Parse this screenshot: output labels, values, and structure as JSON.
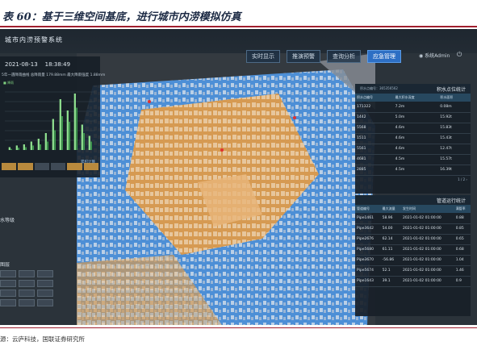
{
  "doc": {
    "title": "表 60：基于三维空间基底，进行城市内涝模拟仿真",
    "source": "源：云庐科技，国联证券研究所"
  },
  "app": {
    "system_title": "城市内涝预警系统",
    "nav_tabs": [
      "实时显示",
      "推演预警",
      "查询分析",
      "应急管理"
    ],
    "active_tab": 3,
    "user_label": "系统Admin"
  },
  "left_panel": {
    "date": "2021-08-13",
    "time": "18:38:49",
    "rain_caption": "5年一遇降雨曲线 总降雨量 179.88mm 最大降雨强度 1.88mm",
    "legend_label": "降雨",
    "buttons": [
      "",
      "",
      "",
      "",
      "",
      ""
    ],
    "data_link": "累积计算",
    "mid_label": "水等级",
    "tools_title": "图层"
  },
  "right_panel_1": {
    "title": "积水点位统计",
    "subtitle": "积水点编号：365356562",
    "columns": [
      "积水点编号",
      "最大积水深度",
      "积水面积"
    ],
    "rows": [
      [
        "171322",
        "7.2m",
        "0.08m"
      ],
      [
        "1442",
        "5.0m",
        "15.92t"
      ],
      [
        "5568",
        "4.6m",
        "15.83t"
      ],
      [
        "1511",
        "4.6m",
        "15.43t"
      ],
      [
        "5561",
        "4.6m",
        "12.47t"
      ],
      [
        "4681",
        "4.5m",
        "15.57t"
      ],
      [
        "2885",
        "4.5m",
        "16.39t"
      ]
    ],
    "pager": "1 / 2  ›"
  },
  "right_panel_2": {
    "title": "管道运行统计",
    "columns": [
      "管道编号",
      "最大流量",
      "发生时间",
      "满管率"
    ],
    "rows": [
      [
        "Pipe1461",
        "58.96",
        "2021-01-02 01:00:00",
        "0.88"
      ],
      [
        "Pipe3642",
        "54.00",
        "2021-01-02 01:00:00",
        "0.85"
      ],
      [
        "Pipe2676",
        "62.14",
        "2021-01-02 01:00:00",
        "0.65"
      ],
      [
        "Pipe5680",
        "61.11",
        "2021-01-02 01:00:00",
        "0.68"
      ],
      [
        "Pipe3670",
        "-56.86",
        "2021-01-02 01:00:00",
        "1.04"
      ],
      [
        "Pipe5674",
        "52.1",
        "2021-01-02 01:00:00",
        "1.46"
      ],
      [
        "Pipe1643",
        "39.1",
        "2021-01-02 01:00:00",
        "0.9"
      ]
    ]
  },
  "rain_bars": {
    "light": [
      0.05,
      0.08,
      0.1,
      0.15,
      0.2,
      0.3,
      0.55,
      0.9,
      0.7,
      1.0,
      0.45,
      0.25
    ],
    "dark": [
      0.02,
      0.04,
      0.05,
      0.08,
      0.1,
      0.15,
      0.35,
      0.6,
      0.5,
      0.75,
      0.3,
      0.15
    ]
  },
  "colors": {
    "water_blue": "#4d8fd6",
    "orange_zone": "#d69a52",
    "brand_red": "#a01e2e",
    "active_tab": "#2d6fc4"
  }
}
